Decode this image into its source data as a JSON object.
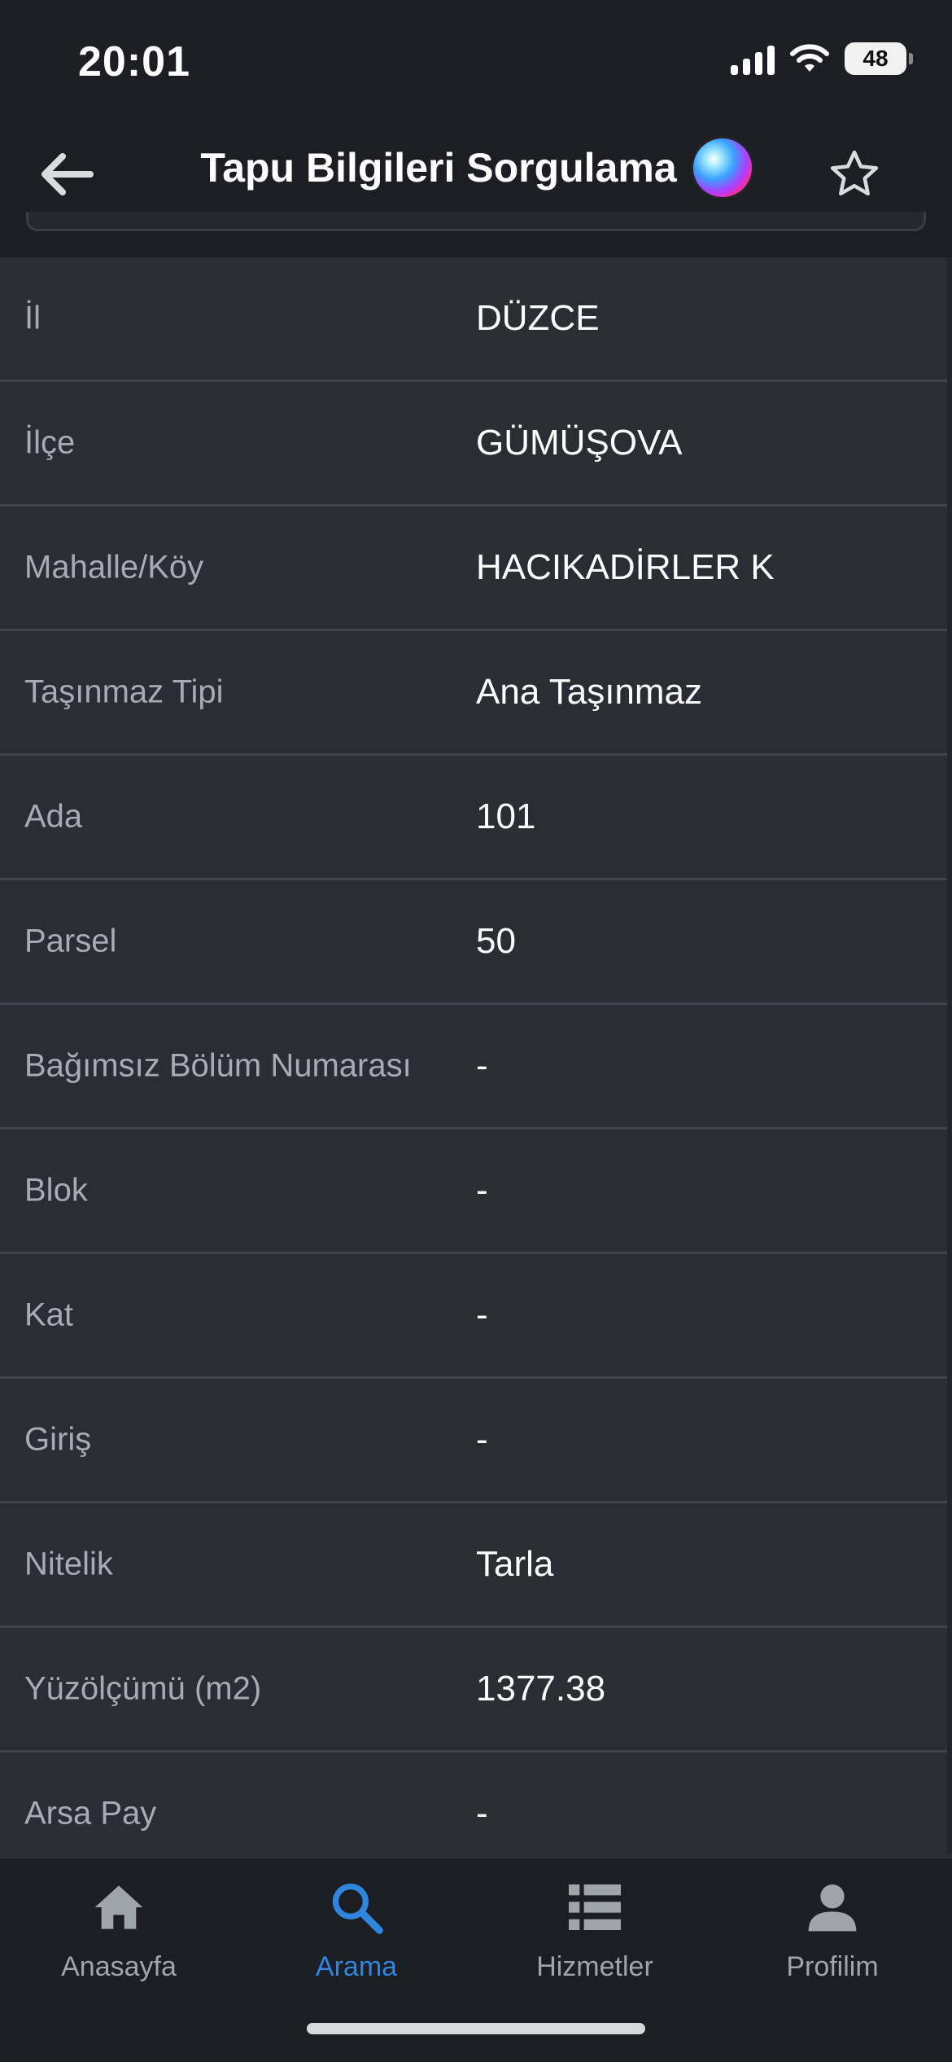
{
  "status_bar": {
    "time": "20:01",
    "battery": "48"
  },
  "nav": {
    "title": "Tapu Bilgileri Sorgulama"
  },
  "rows": [
    {
      "label": "İl",
      "value": "DÜZCE"
    },
    {
      "label": "İlçe",
      "value": "GÜMÜŞOVA"
    },
    {
      "label": "Mahalle/Köy",
      "value": "HACIKADİRLER K"
    },
    {
      "label": "Taşınmaz Tipi",
      "value": "Ana Taşınmaz"
    },
    {
      "label": "Ada",
      "value": "101"
    },
    {
      "label": "Parsel",
      "value": "50"
    },
    {
      "label": "Bağımsız Bölüm Numarası",
      "value": "-"
    },
    {
      "label": "Blok",
      "value": "-"
    },
    {
      "label": "Kat",
      "value": "-"
    },
    {
      "label": "Giriş",
      "value": "-"
    },
    {
      "label": "Nitelik",
      "value": "Tarla"
    },
    {
      "label": "Yüzölçümü (m2)",
      "value": "1377.38"
    },
    {
      "label": "Arsa Pay",
      "value": "-"
    }
  ],
  "tabs": [
    {
      "label": "Anasayfa",
      "icon": "home-icon",
      "active": false
    },
    {
      "label": "Arama",
      "icon": "search-icon",
      "active": true
    },
    {
      "label": "Hizmetler",
      "icon": "list-icon",
      "active": false
    },
    {
      "label": "Profilim",
      "icon": "person-icon",
      "active": false
    }
  ],
  "colors": {
    "background": "#1c1e23",
    "row_background": "#2a2d33",
    "accent": "#2e86de",
    "label_text": "#a7abb3"
  }
}
